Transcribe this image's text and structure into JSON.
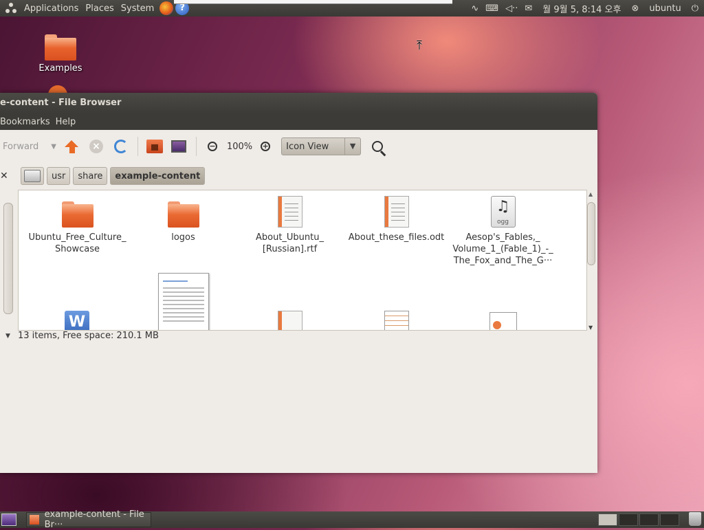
{
  "top_panel": {
    "menus": [
      "Applications",
      "Places",
      "System"
    ],
    "clock": "월 9월  5,  8:14 오후",
    "user": "ubuntu",
    "tray_icons": [
      "network-icon",
      "keyboard-icon",
      "volume-icon",
      "mail-icon",
      "session-icon",
      "power-icon"
    ]
  },
  "desktop": {
    "icons": [
      {
        "label": "Examples",
        "icon": "folder-icon"
      }
    ]
  },
  "window": {
    "title": "e-content - File Browser",
    "menu": [
      "Bookmarks",
      "Help"
    ],
    "toolbar": {
      "forward_label": "Forward",
      "zoom_level": "100%",
      "view_mode": "Icon View"
    },
    "path": [
      "usr",
      "share",
      "example-content"
    ],
    "files": [
      {
        "name": "Ubuntu_Free_Culture_\nShowcase",
        "type": "folder"
      },
      {
        "name": "logos",
        "type": "folder"
      },
      {
        "name": "About_Ubuntu_\n[Russian].rtf",
        "type": "document"
      },
      {
        "name": "About_these_files.odt",
        "type": "document"
      },
      {
        "name": "Aesop's_Fables,_\nVolume_1_(Fable_1)_-_\nThe_Fox_and_The_G···",
        "type": "audio",
        "badge": "ogg"
      }
    ],
    "status": "13 items, Free space: 210.1 MB"
  },
  "bottom_panel": {
    "task_label": "example-content - File Br···"
  },
  "colors": {
    "panel": "#3c3b37",
    "window_bg": "#efebe7",
    "folder_orange": "#e8632e",
    "accent_blue": "#3f86d5"
  }
}
